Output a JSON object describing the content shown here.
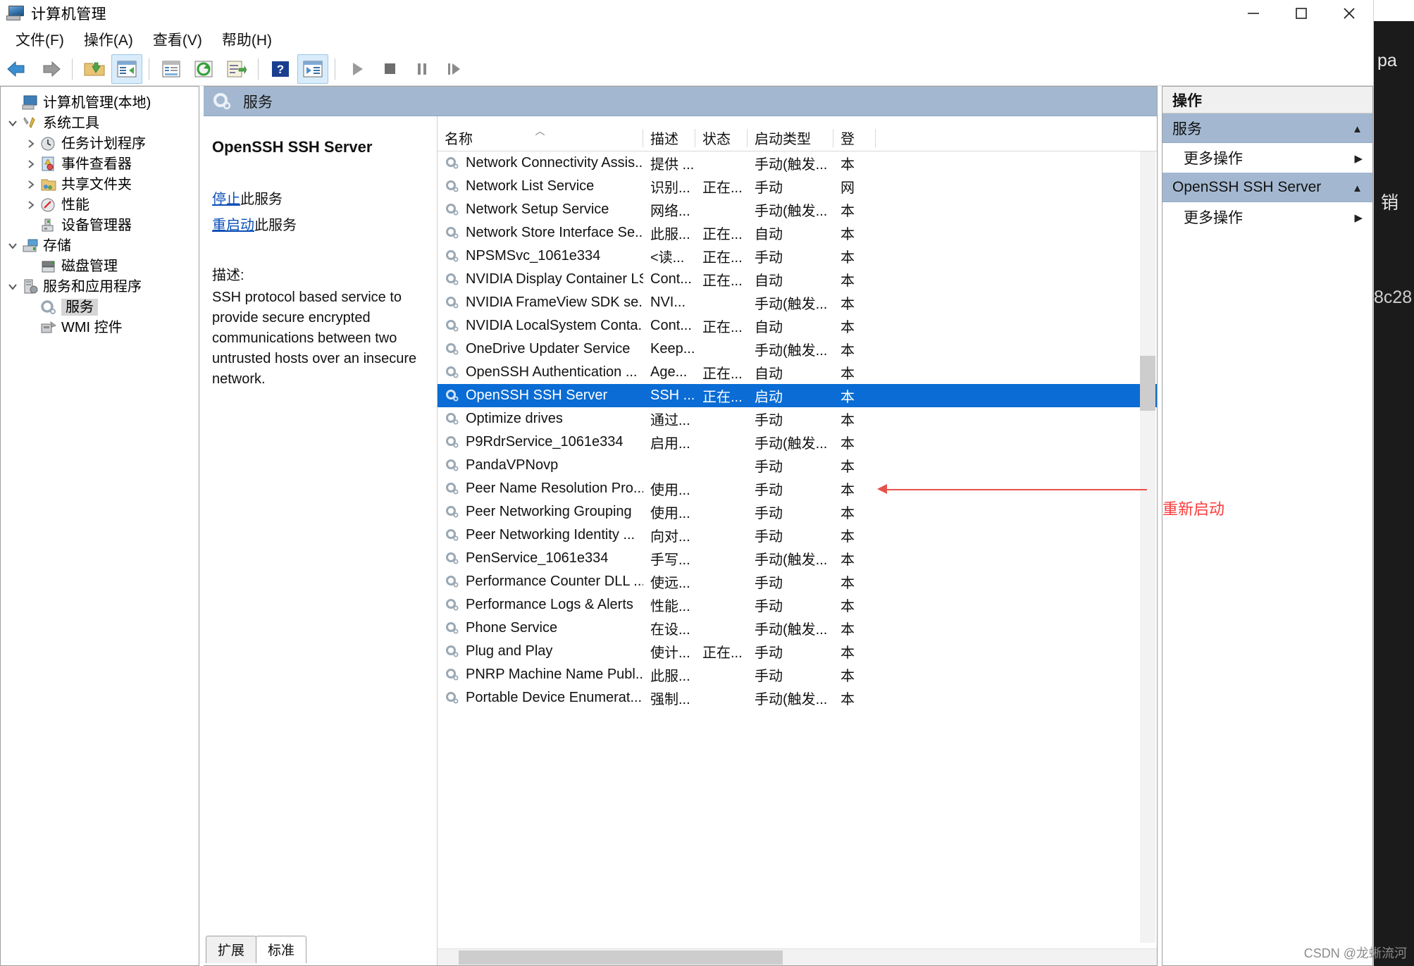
{
  "window": {
    "title": "计算机管理",
    "icon": "computer-management-icon",
    "minimize": "最小化",
    "maximize": "最大化",
    "close": "关闭"
  },
  "menubar": [
    {
      "label": "文件(F)"
    },
    {
      "label": "操作(A)"
    },
    {
      "label": "查看(V)"
    },
    {
      "label": "帮助(H)"
    }
  ],
  "toolbar": [
    {
      "name": "back-icon",
      "glyph": "back"
    },
    {
      "name": "forward-icon",
      "glyph": "forward"
    },
    {
      "name": "up-folder-icon",
      "glyph": "folder"
    },
    {
      "name": "show-hide-tree-icon",
      "glyph": "treepane",
      "active": true
    },
    {
      "name": "properties-icon",
      "glyph": "props"
    },
    {
      "name": "refresh-icon",
      "glyph": "refresh"
    },
    {
      "name": "export-list-icon",
      "glyph": "export"
    },
    {
      "name": "help-icon",
      "glyph": "help"
    },
    {
      "name": "show-action-pane-icon",
      "glyph": "actionpane",
      "active": true
    },
    {
      "name": "start-service-icon",
      "glyph": "play"
    },
    {
      "name": "stop-service-icon",
      "glyph": "stop"
    },
    {
      "name": "pause-service-icon",
      "glyph": "pause"
    },
    {
      "name": "restart-service-icon",
      "glyph": "restart"
    }
  ],
  "tree": [
    {
      "label": "计算机管理(本地)",
      "indent": 0,
      "twist": "",
      "icon": "computer-icon",
      "selected": false
    },
    {
      "label": "系统工具",
      "indent": 1,
      "twist": "v",
      "icon": "tools-icon",
      "selected": false
    },
    {
      "label": "任务计划程序",
      "indent": 2,
      "twist": ">",
      "icon": "clock-icon",
      "selected": false
    },
    {
      "label": "事件查看器",
      "indent": 2,
      "twist": ">",
      "icon": "event-viewer-icon",
      "selected": false
    },
    {
      "label": "共享文件夹",
      "indent": 2,
      "twist": ">",
      "icon": "shared-folder-icon",
      "selected": false
    },
    {
      "label": "性能",
      "indent": 2,
      "twist": ">",
      "icon": "performance-icon",
      "selected": false
    },
    {
      "label": "设备管理器",
      "indent": 2,
      "twist": "",
      "icon": "device-manager-icon",
      "selected": false
    },
    {
      "label": "存储",
      "indent": 1,
      "twist": "v",
      "icon": "storage-icon",
      "selected": false
    },
    {
      "label": "磁盘管理",
      "indent": 2,
      "twist": "",
      "icon": "disk-icon",
      "selected": false
    },
    {
      "label": "服务和应用程序",
      "indent": 1,
      "twist": "v",
      "icon": "services-apps-icon",
      "selected": false
    },
    {
      "label": "服务",
      "indent": 2,
      "twist": "",
      "icon": "service-gear-icon",
      "selected": true
    },
    {
      "label": "WMI 控件",
      "indent": 2,
      "twist": "",
      "icon": "wmi-icon",
      "selected": false
    }
  ],
  "content": {
    "pane_header": "服务",
    "pane_header_icon": "service-gear-icon",
    "detail": {
      "service_name": "OpenSSH SSH Server",
      "stop_link": "停止",
      "stop_suffix": "此服务",
      "restart_link": "重启动",
      "restart_suffix": "此服务",
      "desc_label": "描述:",
      "desc_body": "SSH protocol based service to provide secure encrypted communications between two untrusted hosts over an insecure network."
    },
    "columns": [
      "名称",
      "描述",
      "状态",
      "启动类型",
      "登"
    ],
    "sort_column": "名称",
    "sort_direction": "asc",
    "rows": [
      {
        "name": "Network Connectivity Assis...",
        "desc": "提供 ...",
        "status": "",
        "startup": "手动(触发...",
        "logon": "本"
      },
      {
        "name": "Network List Service",
        "desc": "识别...",
        "status": "正在...",
        "startup": "手动",
        "logon": "网"
      },
      {
        "name": "Network Setup Service",
        "desc": "网络...",
        "status": "",
        "startup": "手动(触发...",
        "logon": "本"
      },
      {
        "name": "Network Store Interface Se...",
        "desc": "此服...",
        "status": "正在...",
        "startup": "自动",
        "logon": "本"
      },
      {
        "name": "NPSMSvc_1061e334",
        "desc": "<读...",
        "status": "正在...",
        "startup": "手动",
        "logon": "本"
      },
      {
        "name": "NVIDIA Display Container LS",
        "desc": "Cont...",
        "status": "正在...",
        "startup": "自动",
        "logon": "本"
      },
      {
        "name": "NVIDIA FrameView SDK se...",
        "desc": "NVI...",
        "status": "",
        "startup": "手动(触发...",
        "logon": "本"
      },
      {
        "name": "NVIDIA LocalSystem Conta...",
        "desc": "Cont...",
        "status": "正在...",
        "startup": "自动",
        "logon": "本"
      },
      {
        "name": "OneDrive Updater Service",
        "desc": "Keep...",
        "status": "",
        "startup": "手动(触发...",
        "logon": "本"
      },
      {
        "name": "OpenSSH Authentication ...",
        "desc": "Age...",
        "status": "正在...",
        "startup": "自动",
        "logon": "本"
      },
      {
        "name": "OpenSSH SSH Server",
        "desc": "SSH ...",
        "status": "正在...",
        "startup": "启动",
        "logon": "本",
        "selected": true
      },
      {
        "name": "Optimize drives",
        "desc": "通过...",
        "status": "",
        "startup": "手动",
        "logon": "本"
      },
      {
        "name": "P9RdrService_1061e334",
        "desc": "启用...",
        "status": "",
        "startup": "手动(触发...",
        "logon": "本"
      },
      {
        "name": "PandaVPNovp",
        "desc": "",
        "status": "",
        "startup": "手动",
        "logon": "本"
      },
      {
        "name": "Peer Name Resolution Pro...",
        "desc": "使用...",
        "status": "",
        "startup": "手动",
        "logon": "本"
      },
      {
        "name": "Peer Networking Grouping",
        "desc": "使用...",
        "status": "",
        "startup": "手动",
        "logon": "本"
      },
      {
        "name": "Peer Networking Identity ...",
        "desc": "向对...",
        "status": "",
        "startup": "手动",
        "logon": "本"
      },
      {
        "name": "PenService_1061e334",
        "desc": "手写...",
        "status": "",
        "startup": "手动(触发...",
        "logon": "本"
      },
      {
        "name": "Performance Counter DLL ...",
        "desc": "使远...",
        "status": "",
        "startup": "手动",
        "logon": "本"
      },
      {
        "name": "Performance Logs & Alerts",
        "desc": "性能...",
        "status": "",
        "startup": "手动",
        "logon": "本"
      },
      {
        "name": "Phone Service",
        "desc": "在设...",
        "status": "",
        "startup": "手动(触发...",
        "logon": "本"
      },
      {
        "name": "Plug and Play",
        "desc": "使计...",
        "status": "正在...",
        "startup": "手动",
        "logon": "本"
      },
      {
        "name": "PNRP Machine Name Publ...",
        "desc": "此服...",
        "status": "",
        "startup": "手动",
        "logon": "本"
      },
      {
        "name": "Portable Device Enumerat...",
        "desc": "强制...",
        "status": "",
        "startup": "手动(触发...",
        "logon": "本"
      }
    ],
    "tabs": [
      {
        "label": "扩展",
        "active": false
      },
      {
        "label": "标准",
        "active": true
      }
    ]
  },
  "actions": {
    "title": "操作",
    "groups": [
      {
        "header": "服务",
        "items": [
          {
            "label": "更多操作"
          }
        ]
      },
      {
        "header": "OpenSSH SSH Server",
        "items": [
          {
            "label": "更多操作"
          }
        ],
        "highlighted": true
      }
    ]
  },
  "annotation": {
    "text": "重新启动",
    "color": "#fb3b3b"
  },
  "desktop": {
    "fragment_top": "pa",
    "fragment_mid": "销",
    "fragment_hex": "8c28"
  },
  "watermark": "CSDN @龙蜥流河",
  "colors": {
    "selection_blue": "#0a6cd4",
    "header_blue": "#a3b8d0",
    "link_blue": "#0b4fb8",
    "annotation_red": "#fb3b3b"
  }
}
